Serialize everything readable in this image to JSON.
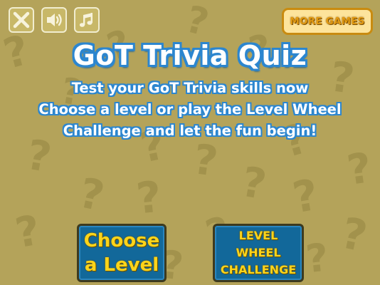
{
  "toolbar": {
    "close_icon": "close-icon",
    "sound_icon": "speaker-icon",
    "music_icon": "music-note-icon",
    "more_games_label": "MORE GAMES"
  },
  "header": {
    "title": "GoT Trivia Quiz",
    "line1": "Test your GoT Trivia skills now",
    "line2": "Choose a level or play the Level Wheel",
    "line3": "Challenge and let the fun begin!"
  },
  "buttons": {
    "choose_level": [
      "Choose",
      "a Level"
    ],
    "level_wheel": [
      "LEVEL",
      "WHEEL",
      "CHALLENGE"
    ]
  },
  "colors": {
    "background": "#b4a35a",
    "pattern": "#a2924c",
    "title_outline": "#2c86cf",
    "button_fill": "#12689a",
    "button_text": "#fcd41a",
    "more_games_fill": "#fde49c"
  }
}
